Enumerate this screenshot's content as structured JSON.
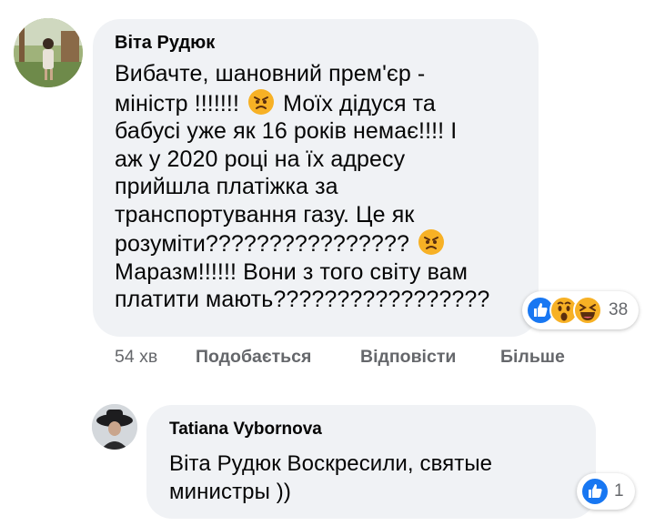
{
  "comment1": {
    "author": "Віта Рудюк",
    "lines": [
      "Вибачте, шановний прем'єр -",
      "міністр !!!!!!!",
      "Моїх дідуся та",
      "бабусі уже як 16 років немає!!!! І",
      "аж у 2020 році на їх адресу",
      "прийшла платіжка за",
      "транспортування газу. Це як",
      "розуміти????????????????",
      "Маразм!!!!!! Вони з того світу вам",
      "платити мають?????????????????"
    ],
    "inline_emoji": "angry-face-icon",
    "reactions": {
      "icons": [
        "like-icon",
        "wow-icon",
        "haha-icon"
      ],
      "count": "38"
    },
    "time": "54 хв",
    "actions": {
      "like": "Подобається",
      "reply": "Відповісти",
      "more": "Більше"
    }
  },
  "comment2": {
    "author": "Tatiana Vybornova",
    "text_line1": "Віта Рудюк Воскресили, святые",
    "text_line2": "министры ))",
    "reactions": {
      "icons": [
        "like-icon"
      ],
      "count": "1"
    }
  },
  "colors": {
    "bubble": "#f0f2f5",
    "secondary_text": "#65676b",
    "like_blue": "#1877f2",
    "emoji_yellow": "#f7b125"
  }
}
